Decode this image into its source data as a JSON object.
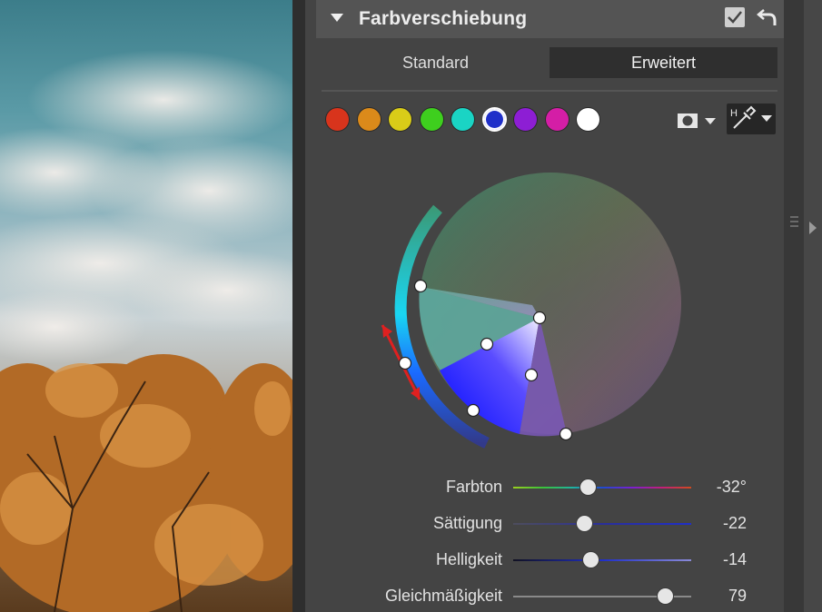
{
  "panel": {
    "title": "Farbverschiebung"
  },
  "tabs": [
    {
      "label": "Standard",
      "active": false
    },
    {
      "label": "Erweitert",
      "active": true
    }
  ],
  "swatches": [
    {
      "color": "#d8341c"
    },
    {
      "color": "#db8a1a"
    },
    {
      "color": "#d9cc18"
    },
    {
      "color": "#3ecf1e"
    },
    {
      "color": "#1ad4c4"
    },
    {
      "color": "#1f2fc9",
      "selected": true
    },
    {
      "color": "#8d1ed4"
    },
    {
      "color": "#d41ea6"
    },
    {
      "color": "#ffffff"
    }
  ],
  "icons": {
    "collapse": "triangle-down-icon",
    "enabled": "checkbox-checked-icon",
    "reset": "undo-arrow-icon",
    "mask": "mask-icon",
    "picker": "eyedropper-icon",
    "expand": "chevron-right-icon"
  },
  "sliders": [
    {
      "label": "Farbton",
      "value": "-32°",
      "position": 0.42,
      "track": "hue"
    },
    {
      "label": "Sättigung",
      "value": "-22",
      "position": 0.4,
      "track": "blue"
    },
    {
      "label": "Helligkeit",
      "value": "-14",
      "position": 0.44,
      "track": "blue"
    },
    {
      "label": "Gleichmäßigkeit",
      "value": "79",
      "position": 0.86,
      "track": "gray"
    }
  ],
  "colors": {
    "accent_range": "#2fd0f0",
    "arrow": "#e02020"
  }
}
